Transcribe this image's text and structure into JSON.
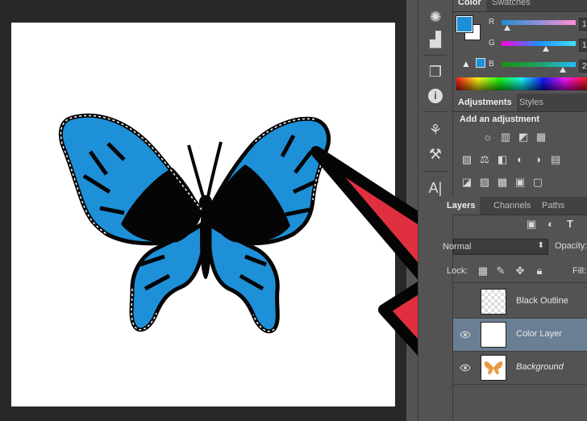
{
  "color_panel": {
    "tabs": [
      "Color",
      "Swatches"
    ],
    "channels": [
      {
        "label": "R",
        "value": "1",
        "fill_fraction": 0.08
      },
      {
        "label": "G",
        "value": "1",
        "fill_fraction": 0.6
      },
      {
        "label": "B",
        "value": "2",
        "fill_fraction": 0.83
      }
    ],
    "foreground_color": "#1a8fd8",
    "background_color": "#ffffff",
    "warning_swatch": "#1e90e0"
  },
  "adjustments_panel": {
    "tabs": [
      "Adjustments",
      "Styles"
    ],
    "heading": "Add an adjustment",
    "icon_rows": [
      [
        "☼",
        "▥",
        "◩",
        "▦"
      ],
      [
        "▧",
        "⚖",
        "◧",
        "◐",
        "◑",
        "▤"
      ],
      [
        "◪",
        "▨",
        "▩",
        "▣",
        "▢"
      ]
    ]
  },
  "layers_panel": {
    "tabs": [
      "Layers",
      "Channels",
      "Paths"
    ],
    "blend_mode": "Normal",
    "opacity_label": "Opacity:",
    "fill_label": "Fill:",
    "lock_label": "Lock:",
    "filter_icons": [
      "▣",
      "◐",
      "T"
    ],
    "layers": [
      {
        "name": "Black Outline",
        "visible": false,
        "selected": false,
        "italic": false
      },
      {
        "name": "Color Layer",
        "visible": true,
        "selected": true,
        "italic": false
      },
      {
        "name": "Background",
        "visible": true,
        "selected": false,
        "italic": true
      }
    ]
  },
  "tools": {
    "icons": [
      "navigator-icon",
      "histogram-icon",
      "properties-icon",
      "info-icon",
      "brush-presets-icon",
      "tool-presets-icon",
      "character-icon"
    ],
    "character_glyph": "A|",
    "info_glyph": "i"
  },
  "colors": {
    "arrow_fill": "#e03040",
    "butterfly_blue": "#1e90d8",
    "butterfly_black": "#050505"
  }
}
